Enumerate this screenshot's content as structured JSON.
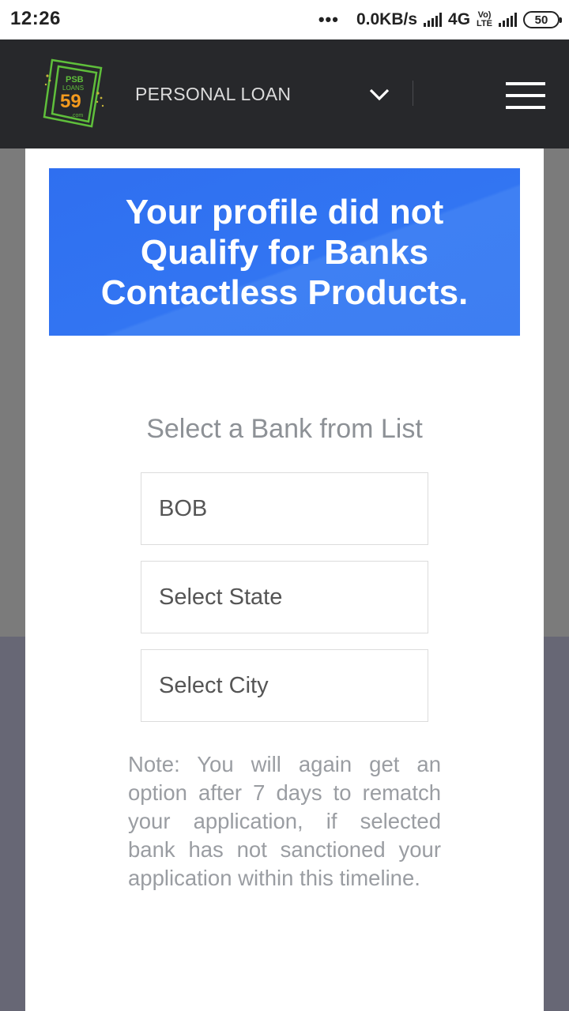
{
  "status_bar": {
    "time": "12:26",
    "dots": "•••",
    "speed": "0.0KB/s",
    "network": "4G",
    "volte_top": "Vo)",
    "volte_bottom": "LTE",
    "battery": "50"
  },
  "header": {
    "logo": {
      "top": "PSB",
      "middle": "LOANS",
      "number": "59",
      "suffix": ".com"
    },
    "nav_label": "PERSONAL LOAN",
    "icons": {
      "dropdown": "chevron-down-icon",
      "menu": "hamburger-menu-icon"
    }
  },
  "banner": {
    "text": "Your profile did not Qualify for Banks Contactless Products."
  },
  "form": {
    "title": "Select a Bank from List",
    "bank_value": "BOB",
    "state_placeholder": "Select State",
    "city_placeholder": "Select City"
  },
  "note": "Note: You will again get an option after 7 days to rematch your application, if selected bank has not sanctioned your application within this timeline.",
  "colors": {
    "header_bg": "#27282b",
    "banner_bg": "#3275f2",
    "logo_green": "#5fbf3b",
    "logo_orange": "#f39a1e"
  }
}
